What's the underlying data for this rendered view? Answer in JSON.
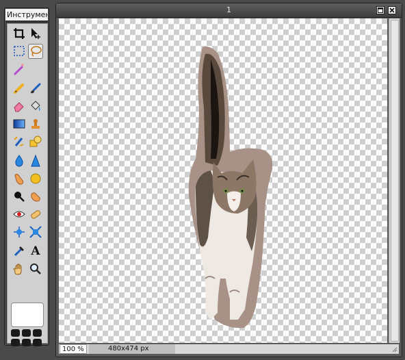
{
  "toolbox": {
    "title": "Инструмент",
    "tools": [
      {
        "name": "crop-tool",
        "icon": "crop-icon"
      },
      {
        "name": "move-tool",
        "icon": "move-arrow-icon"
      },
      {
        "name": "marquee-tool",
        "icon": "marquee-select-icon"
      },
      {
        "name": "lasso-tool",
        "icon": "lasso-icon",
        "active": true
      },
      {
        "name": "magic-wand-tool",
        "icon": "magic-wand-icon"
      },
      {
        "name": "pencil-tool",
        "icon": "pencil-icon"
      },
      {
        "name": "brush-tool",
        "icon": "brush-icon"
      },
      {
        "name": "eraser-tool",
        "icon": "eraser-icon"
      },
      {
        "name": "fill-tool",
        "icon": "paint-bucket-icon"
      },
      {
        "name": "gradient-tool",
        "icon": "gradient-icon"
      },
      {
        "name": "stamp-tool",
        "icon": "clone-stamp-icon"
      },
      {
        "name": "color-replace-tool",
        "icon": "color-replace-icon"
      },
      {
        "name": "shape-tool",
        "icon": "shape-icon"
      },
      {
        "name": "blur-tool",
        "icon": "blur-drop-icon"
      },
      {
        "name": "sharpen-tool",
        "icon": "sharpen-icon"
      },
      {
        "name": "smudge-tool",
        "icon": "smudge-finger-icon"
      },
      {
        "name": "sponge-tool",
        "icon": "sponge-icon"
      },
      {
        "name": "burn-tool",
        "icon": "burn-icon"
      },
      {
        "name": "dodge-tool",
        "icon": "dodge-icon"
      },
      {
        "name": "red-eye-tool",
        "icon": "red-eye-icon"
      },
      {
        "name": "spot-heal-tool",
        "icon": "bandage-icon"
      },
      {
        "name": "bloat-tool",
        "icon": "bloat-icon"
      },
      {
        "name": "pinch-tool",
        "icon": "pinch-icon"
      },
      {
        "name": "color-picker-tool",
        "icon": "eyedropper-icon"
      },
      {
        "name": "text-tool",
        "icon": "text-icon",
        "glyph": "A"
      },
      {
        "name": "hand-tool",
        "icon": "hand-icon"
      },
      {
        "name": "zoom-tool",
        "icon": "magnifier-icon"
      }
    ],
    "swatch_color": "#ffffff"
  },
  "document": {
    "title": "1",
    "zoom": "100 %",
    "size": "480x474 px"
  },
  "colors": {
    "accent_blue": "#2a7ed6",
    "checker_dark": "#cfcfcf",
    "checker_light": "#ffffff"
  }
}
